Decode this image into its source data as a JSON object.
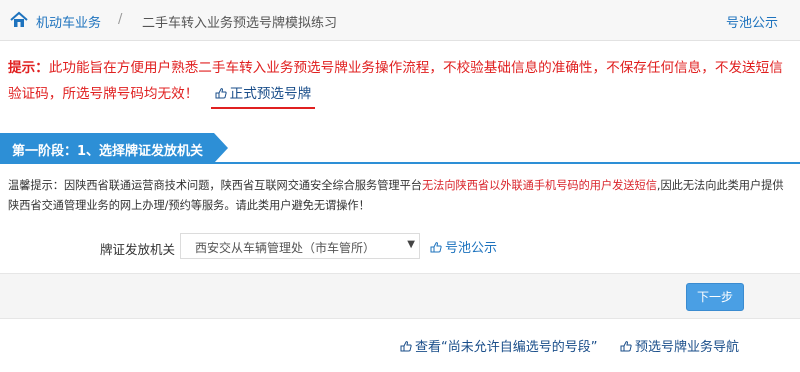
{
  "breadcrumb": {
    "home": "机动车业务",
    "separator": "/",
    "current": "二手车转入业务预选号牌模拟练习"
  },
  "header": {
    "pool_link": "号池公示"
  },
  "notice": {
    "label": "提示：",
    "text": "此功能旨在方便用户熟悉二手车转入业务预选号牌业务操作流程，不校验基础信息的准确性，不保存任何信息，不发送短信验证码，所选号牌号码均无效！",
    "official_link": "正式预选号牌"
  },
  "stage": {
    "title": "第一阶段：1、选择牌证发放机关"
  },
  "hint": {
    "part1": "温馨提示：因陕西省联通运营商技术问题，陕西省互联网交通安全综合服务管理平台",
    "highlight": "无法向陕西省以外联通手机号码的用户发送短信",
    "part2": ",因此无法向此类用户提供陕西省交通管理业务的网上办理/预约等服务。请此类用户避免无谓操作！"
  },
  "form": {
    "label": "牌证发放机关",
    "selected": "西安交从车辆管理处（市车管所）",
    "pool_link": "号池公示"
  },
  "actions": {
    "next": "下一步"
  },
  "bottom_links": {
    "view_segments": "查看“尚未允许自编选号的号段”",
    "guide": "预选号牌业务导航"
  },
  "colors": {
    "accent": "#1e73be",
    "warning": "#e02020",
    "banner": "#2d8fd6",
    "button": "#4a9fe4"
  },
  "icons": [
    "home-icon",
    "hand-point-icon",
    "chevron-down-icon"
  ]
}
